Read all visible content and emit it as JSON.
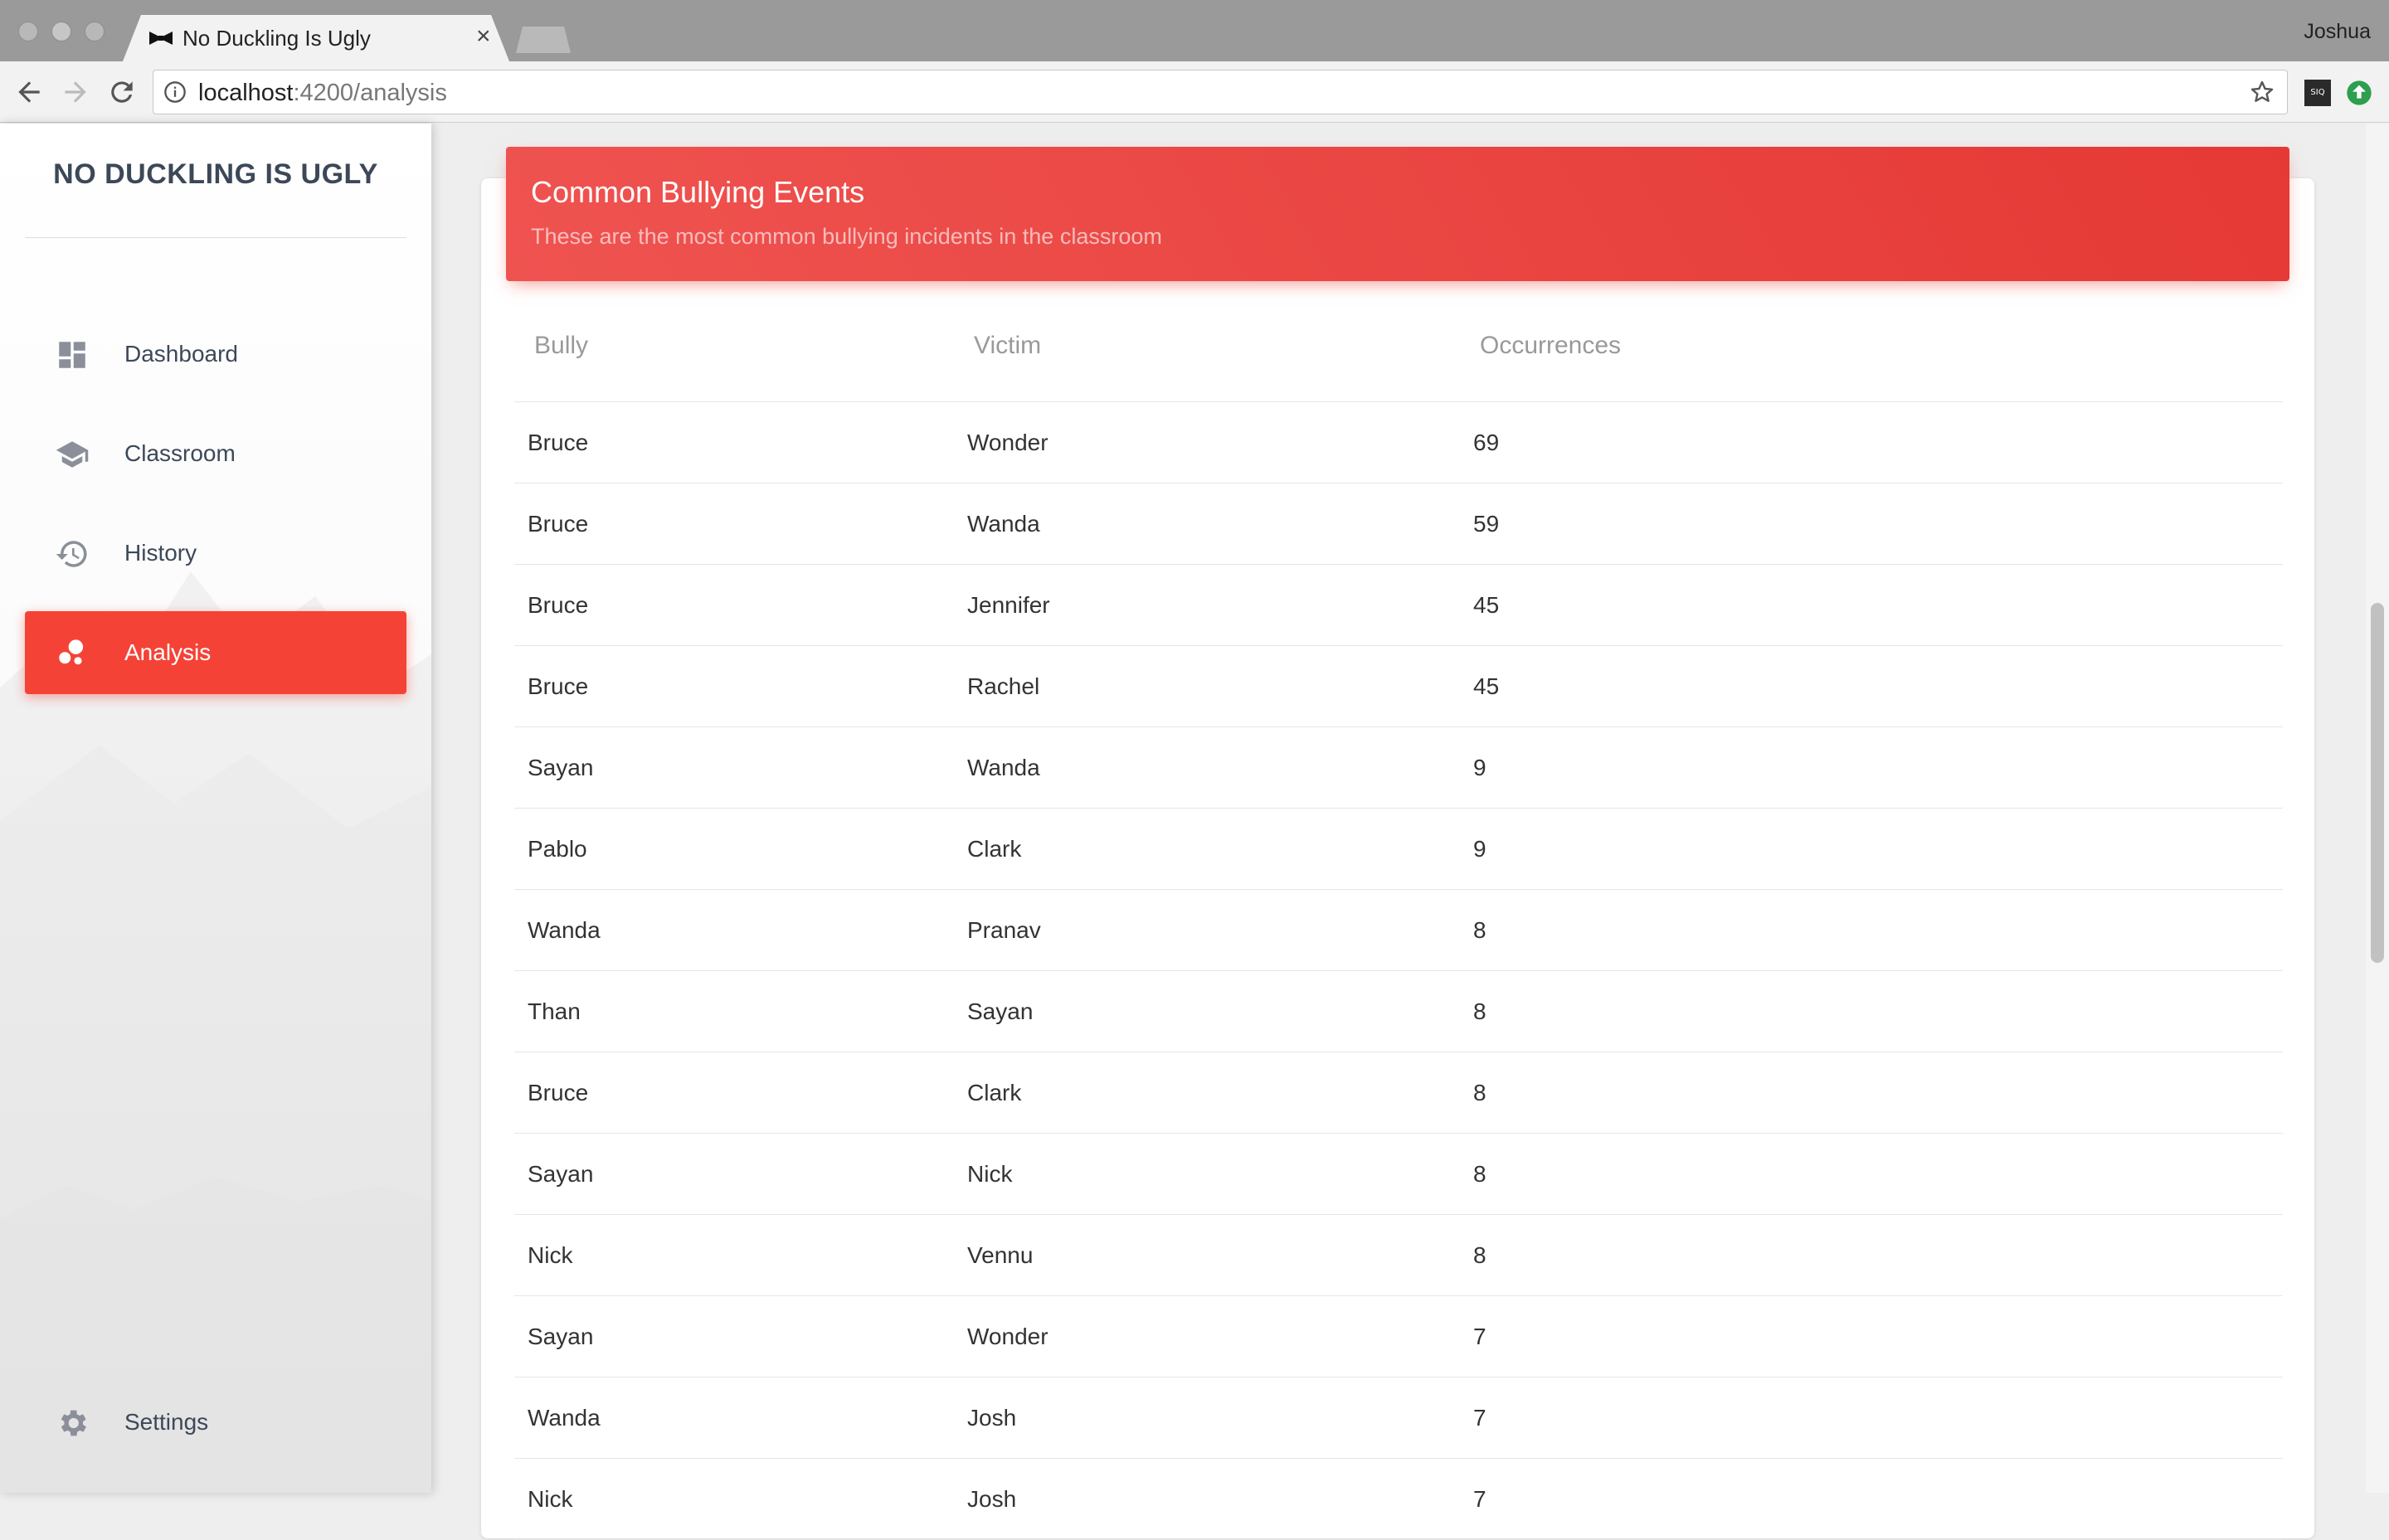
{
  "browser": {
    "tab_title": "No Duckling Is Ugly",
    "tab_close": "×",
    "profile_name": "Joshua",
    "url_host": "localhost",
    "url_path": ":4200/analysis",
    "extension_label": "SIQ"
  },
  "sidebar": {
    "brand": "NO DUCKLING IS UGLY",
    "items": [
      {
        "label": "Dashboard",
        "icon": "dashboard-icon"
      },
      {
        "label": "Classroom",
        "icon": "school-icon"
      },
      {
        "label": "History",
        "icon": "history-icon"
      },
      {
        "label": "Analysis",
        "icon": "bubble-chart-icon",
        "active": true
      }
    ],
    "settings": {
      "label": "Settings",
      "icon": "gear-icon"
    }
  },
  "card": {
    "title": "Common Bullying Events",
    "subtitle": "These are the most common bullying incidents in the classroom"
  },
  "table": {
    "headers": [
      "Bully",
      "Victim",
      "Occurrences"
    ],
    "rows": [
      [
        "Bruce",
        "Wonder",
        "69"
      ],
      [
        "Bruce",
        "Wanda",
        "59"
      ],
      [
        "Bruce",
        "Jennifer",
        "45"
      ],
      [
        "Bruce",
        "Rachel",
        "45"
      ],
      [
        "Sayan",
        "Wanda",
        "9"
      ],
      [
        "Pablo",
        "Clark",
        "9"
      ],
      [
        "Wanda",
        "Pranav",
        "8"
      ],
      [
        "Than",
        "Sayan",
        "8"
      ],
      [
        "Bruce",
        "Clark",
        "8"
      ],
      [
        "Sayan",
        "Nick",
        "8"
      ],
      [
        "Nick",
        "Vennu",
        "8"
      ],
      [
        "Sayan",
        "Wonder",
        "7"
      ],
      [
        "Wanda",
        "Josh",
        "7"
      ],
      [
        "Nick",
        "Josh",
        "7"
      ]
    ]
  },
  "colors": {
    "accent": "#f44336",
    "header_gradient_start": "#ef5350",
    "header_gradient_end": "#e53935",
    "sidebar_text": "#3c4858"
  }
}
